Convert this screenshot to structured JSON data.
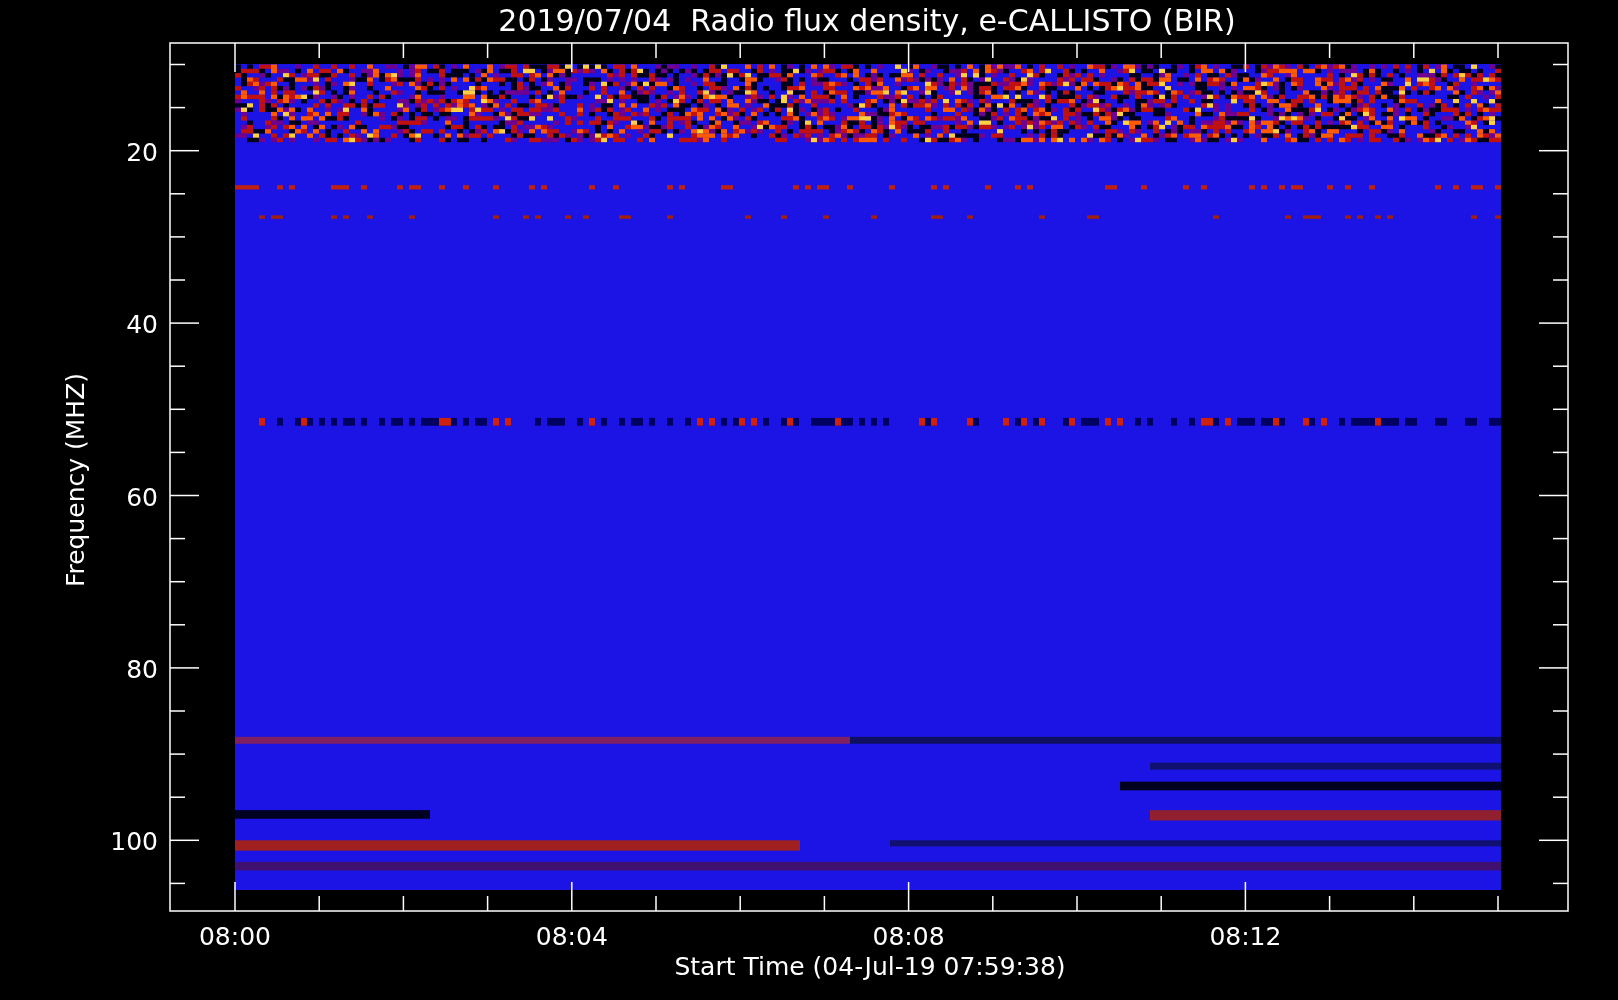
{
  "title": "2019/07/04  Radio flux density, e-CALLISTO (BIR)",
  "y_axis": {
    "label": "Frequency (MHZ)",
    "ticks": [
      "20",
      "40",
      "60",
      "80",
      "100"
    ]
  },
  "x_axis": {
    "label": "Start Time (04-Jul-19 07:59:38)",
    "ticks": [
      "08:00",
      "08:04",
      "08:08",
      "08:12"
    ]
  }
}
